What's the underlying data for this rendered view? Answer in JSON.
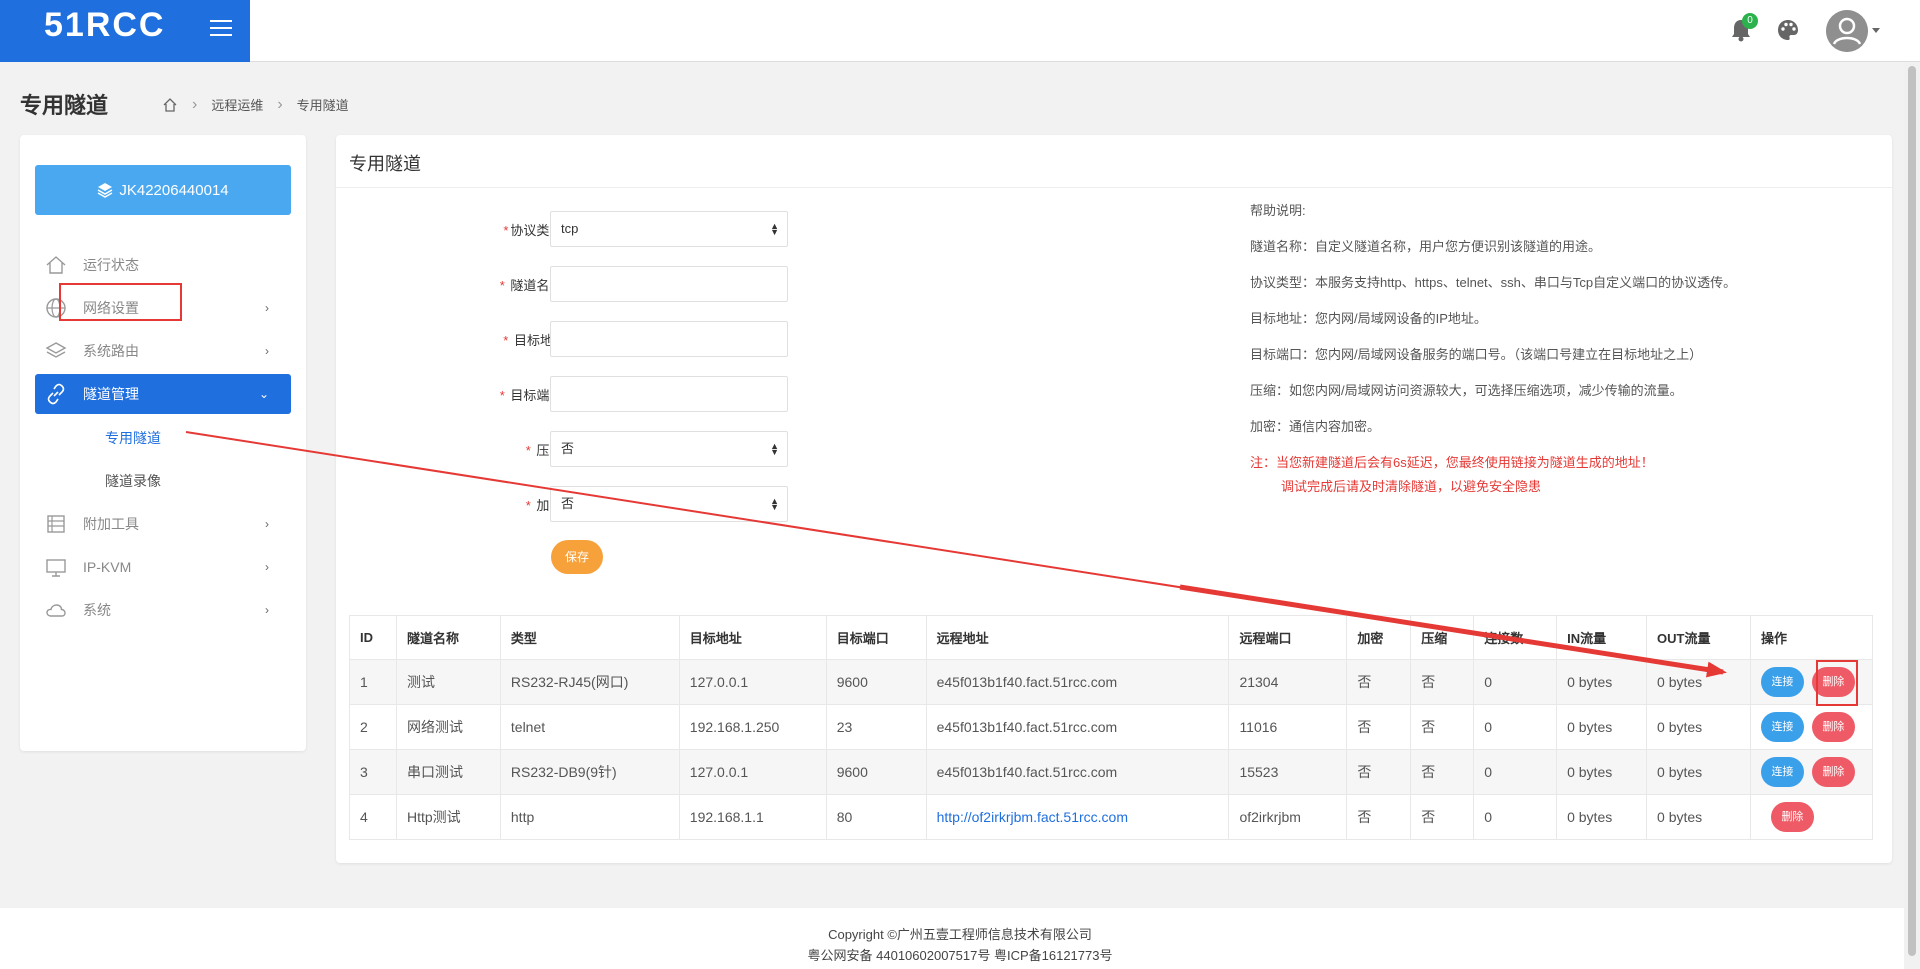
{
  "app": {
    "logo_text": "51RCC",
    "notification_count": "0"
  },
  "page": {
    "title": "专用隧道",
    "breadcrumb": [
      "远程运维",
      "专用隧道"
    ]
  },
  "sidebar": {
    "device_id": "JK42206440014",
    "items": [
      {
        "label": "运行状态",
        "icon": "home-icon",
        "has_children": false
      },
      {
        "label": "网络设置",
        "icon": "globe-icon",
        "has_children": true
      },
      {
        "label": "系统路由",
        "icon": "layers-icon",
        "has_children": true
      },
      {
        "label": "隧道管理",
        "icon": "link-icon",
        "has_children": true,
        "active": true
      },
      {
        "label": "附加工具",
        "icon": "toolbox-icon",
        "has_children": true
      },
      {
        "label": "IP-KVM",
        "icon": "monitor-icon",
        "has_children": true
      },
      {
        "label": "系统",
        "icon": "cloud-icon",
        "has_children": true
      }
    ],
    "sub_items": [
      "专用隧道",
      "隧道录像"
    ]
  },
  "main": {
    "title": "专用隧道",
    "form": {
      "protocol_label": "协议类型:",
      "protocol_value": "tcp",
      "name_label": "隧道名称:",
      "name_value": "",
      "target_addr_label": "目标地址",
      "target_addr_value": "",
      "target_port_label": "目标端口:",
      "target_port_value": "",
      "compress_label": "压缩:",
      "compress_value": "否",
      "encrypt_label": "加密:",
      "encrypt_value": "否",
      "save_label": "保存"
    },
    "help": {
      "title": "帮助说明:",
      "lines": [
        "隧道名称：自定义隧道名称，用户您方便识别该隧道的用途。",
        "协议类型：本服务支持http、https、telnet、ssh、串口与Tcp自定义端口的协议透传。",
        "目标地址：您内网/局域网设备的IP地址。",
        "目标端口：您内网/局域网设备服务的端口号。（该端口号建立在目标地址之上）",
        "压缩：如您内网/局域网访问资源较大，可选择压缩选项，减少传输的流量。",
        "加密：通信内容加密。"
      ],
      "warning": "注：当您新建隧道后会有6s延迟，您最终使用链接为隧道生成的地址！",
      "warning2": "调试完成后请及时清除隧道，以避免安全隐患"
    },
    "table": {
      "headers": [
        "ID",
        "隧道名称",
        "类型",
        "目标地址",
        "目标端口",
        "远程地址",
        "远程端口",
        "加密",
        "压缩",
        "连接数",
        "IN流量",
        "OUT流量",
        "操作"
      ],
      "rows": [
        {
          "id": "1",
          "name": "测试",
          "type": "RS232-RJ45(网口)",
          "target": "127.0.0.1",
          "port": "9600",
          "remote": "e45f013b1f40.fact.51rcc.com",
          "remote_port": "21304",
          "enc": "否",
          "comp": "否",
          "conns": "0",
          "in": "0 bytes",
          "out": "0 bytes",
          "connect": "连接",
          "delete": "删除"
        },
        {
          "id": "2",
          "name": "网络测试",
          "type": "telnet",
          "target": "192.168.1.250",
          "port": "23",
          "remote": "e45f013b1f40.fact.51rcc.com",
          "remote_port": "11016",
          "enc": "否",
          "comp": "否",
          "conns": "0",
          "in": "0 bytes",
          "out": "0 bytes",
          "connect": "连接",
          "delete": "删除"
        },
        {
          "id": "3",
          "name": "串口测试",
          "type": "RS232-DB9(9针)",
          "target": "127.0.0.1",
          "port": "9600",
          "remote": "e45f013b1f40.fact.51rcc.com",
          "remote_port": "15523",
          "enc": "否",
          "comp": "否",
          "conns": "0",
          "in": "0 bytes",
          "out": "0 bytes",
          "connect": "连接",
          "delete": "删除"
        },
        {
          "id": "4",
          "name": "Http测试",
          "type": "http",
          "target": "192.168.1.1",
          "port": "80",
          "remote": "http://of2irkrjbm.fact.51rcc.com",
          "remote_port": "of2irkrjbm",
          "enc": "否",
          "comp": "否",
          "conns": "0",
          "in": "0 bytes",
          "out": "0 bytes",
          "connect": "",
          "delete": "删除"
        }
      ]
    }
  },
  "footer": {
    "copyright": "Copyright ©广州五壹工程师信息技术有限公司",
    "icp": "粤公网安备 44010602007517号 粤ICP备16121773号"
  },
  "colors": {
    "brand": "#1f6fde",
    "device_button": "#4aa8f0",
    "save": "#f7a13a",
    "connect": "#3ba0ea",
    "delete": "#ee5a65",
    "annotation": "#e53935"
  }
}
